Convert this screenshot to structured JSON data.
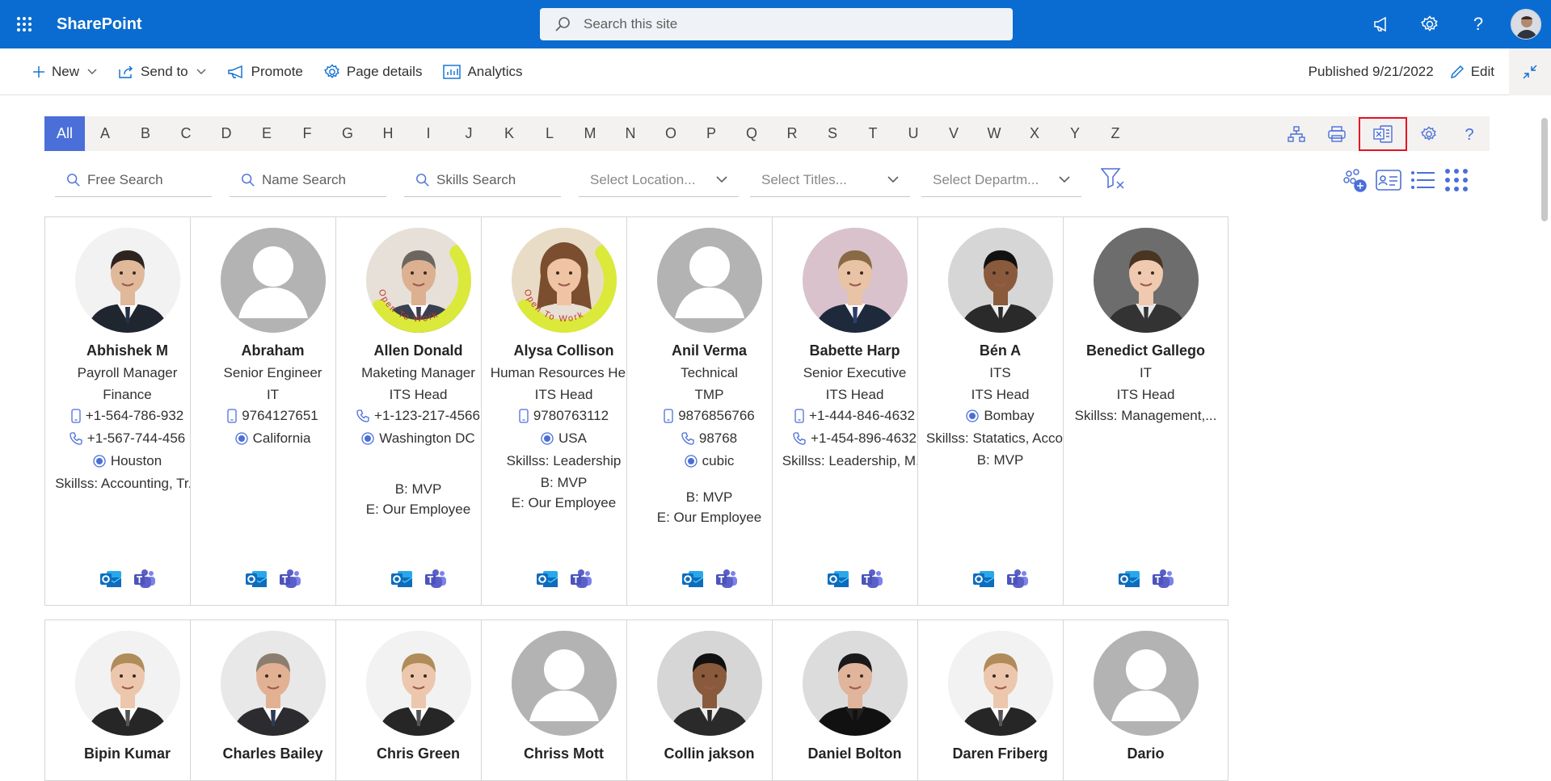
{
  "suite": {
    "app_name": "SharePoint",
    "search_placeholder": "Search this site"
  },
  "commands": {
    "new": "New",
    "send_to": "Send to",
    "promote": "Promote",
    "page_details": "Page details",
    "analytics": "Analytics",
    "published": "Published 9/21/2022",
    "edit": "Edit"
  },
  "alphabet": [
    "All",
    "A",
    "B",
    "C",
    "D",
    "E",
    "F",
    "G",
    "H",
    "I",
    "J",
    "K",
    "L",
    "M",
    "N",
    "O",
    "P",
    "Q",
    "R",
    "S",
    "T",
    "U",
    "V",
    "W",
    "X",
    "Y",
    "Z"
  ],
  "filters": {
    "free_search": "Free Search",
    "name_search": "Name Search",
    "skills_search": "Skills Search",
    "location": "Select Location...",
    "titles": "Select Titles...",
    "department": "Select Departm..."
  },
  "cards_row1": [
    {
      "name": "Abhishek M",
      "title": "Payroll Manager",
      "dept": "Finance",
      "mobile": "+1-564-786-932",
      "phone": "+1-567-744-456",
      "location": "Houston",
      "skills": "Skillss: Accounting, Tr...",
      "photo": "man-suit-1"
    },
    {
      "name": "Abraham",
      "title": "Senior Engineer",
      "dept": "IT",
      "mobile": "9764127651",
      "location": "California",
      "photo": "placeholder"
    },
    {
      "name": "Allen Donald",
      "title": "Maketing Manager",
      "dept": "ITS Head",
      "phone": "+1-123-217-4566",
      "location": "Washington DC",
      "b": "B: MVP",
      "e": "E: Our Employee",
      "photo": "man-otw",
      "otw": "Open To Work"
    },
    {
      "name": "Alysa Collison",
      "title": "Human Resources He...",
      "dept": "ITS Head",
      "mobile": "9780763112",
      "location": "USA",
      "skills": "Skillss: Leadership",
      "b": "B: MVP",
      "e": "E: Our Employee",
      "photo": "woman-otw",
      "otw": "Open To Work"
    },
    {
      "name": "Anil Verma",
      "title": "Technical",
      "dept": "TMP",
      "mobile": "9876856766",
      "phone": "98768",
      "location": "cubic",
      "b": "B: MVP",
      "e": "E: Our Employee",
      "photo": "placeholder"
    },
    {
      "name": "Babette Harp",
      "title": "Senior Executive",
      "dept": "ITS Head",
      "mobile": "+1-444-846-4632",
      "phone": "+1-454-896-4632",
      "skills": "Skillss: Leadership, M...",
      "photo": "man-suit-2"
    },
    {
      "name": "Bén A",
      "title": "ITS",
      "dept": "ITS Head",
      "location": "Bombay",
      "skills": "Skillss: Statatics, Acco...",
      "b": "B: MVP",
      "photo": "man-dark"
    },
    {
      "name": "Benedict Gallego",
      "title": "IT",
      "dept": "ITS Head",
      "skills": "Skillss: Management,...",
      "photo": "young-man"
    }
  ],
  "cards_row2": [
    {
      "name": "Bipin Kumar",
      "photo": "man-suit-3"
    },
    {
      "name": "Charles Bailey",
      "photo": "man-older"
    },
    {
      "name": "Chris Green",
      "photo": "man-suit-3"
    },
    {
      "name": "Chriss Mott",
      "photo": "placeholder"
    },
    {
      "name": "Collin jakson",
      "photo": "man-dark"
    },
    {
      "name": "Daniel Bolton",
      "photo": "man-leather"
    },
    {
      "name": "Daren Friberg",
      "photo": "man-suit-3"
    },
    {
      "name": "Dario",
      "photo": "placeholder"
    }
  ],
  "colors": {
    "suitebar": "#0a6cd0",
    "accent": "#4b6fd8",
    "outlook": "#0f6cbd",
    "teams": "#5b5fc7",
    "otw_ring": "#dbe93a"
  }
}
